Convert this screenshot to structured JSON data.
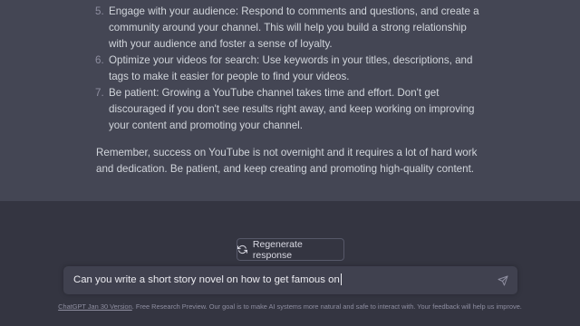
{
  "response": {
    "list": [
      {
        "number": "5.",
        "text": "Engage with your audience: Respond to comments and questions, and create a community around your channel. This will help you build a strong relationship with your audience and foster a sense of loyalty."
      },
      {
        "number": "6.",
        "text": "Optimize your videos for search: Use keywords in your titles, descriptions, and tags to make it easier for people to find your videos."
      },
      {
        "number": "7.",
        "text": "Be patient: Growing a YouTube channel takes time and effort. Don't get discouraged if you don't see results right away, and keep working on improving your content and promoting your channel."
      }
    ],
    "closing": "Remember, success on YouTube is not overnight and it requires a lot of hard work and dedication. Be patient, and keep creating and promoting high-quality content."
  },
  "regenerate_label": "Regenerate response",
  "prompt": {
    "value": "Can you write a short story novel on how to get famous on"
  },
  "footer": {
    "link_text": "ChatGPT Jan 30 Version",
    "text": ". Free Research Preview. Our goal is to make AI systems more natural and safe to interact with. Your feedback will help us improve."
  },
  "icons": {
    "regenerate": "refresh-icon",
    "send": "send-icon"
  },
  "colors": {
    "background": "#343541",
    "response_background": "#444654",
    "input_background": "#40414f"
  }
}
